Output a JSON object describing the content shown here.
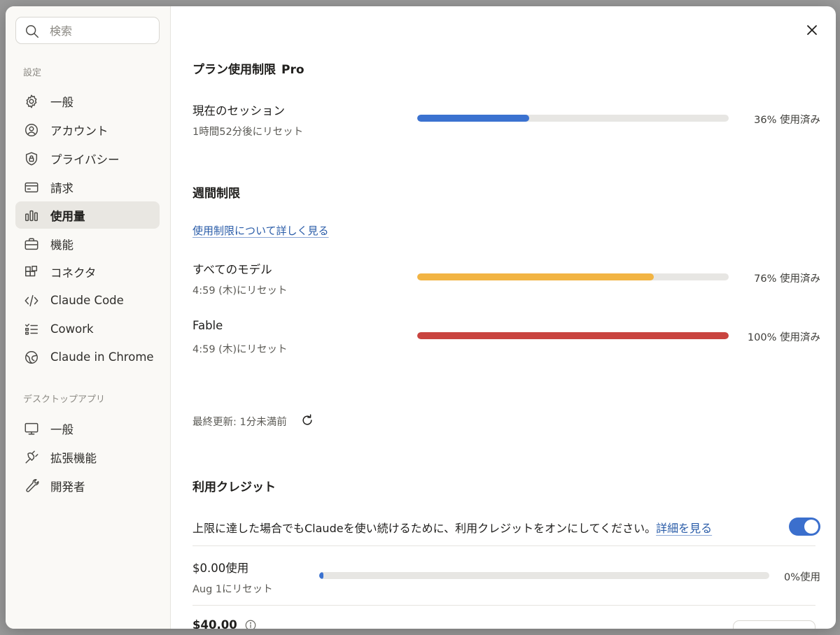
{
  "search": {
    "placeholder": "検索"
  },
  "sidebar": {
    "settings_section": "設定",
    "settings_items": [
      {
        "label": "一般",
        "icon": "gear-icon"
      },
      {
        "label": "アカウント",
        "icon": "user-circle-icon"
      },
      {
        "label": "プライバシー",
        "icon": "shield-lock-icon"
      },
      {
        "label": "請求",
        "icon": "credit-card-icon"
      },
      {
        "label": "使用量",
        "icon": "bar-chart-icon",
        "active": true
      },
      {
        "label": "機能",
        "icon": "briefcase-icon"
      },
      {
        "label": "コネクタ",
        "icon": "blocks-icon"
      },
      {
        "label": "Claude Code",
        "icon": "code-icon"
      },
      {
        "label": "Cowork",
        "icon": "checklist-icon"
      },
      {
        "label": "Claude in Chrome",
        "icon": "globe-icon"
      }
    ],
    "desktop_section": "デスクトップアプリ",
    "desktop_items": [
      {
        "label": "一般",
        "icon": "monitor-icon"
      },
      {
        "label": "拡張機能",
        "icon": "plug-icon"
      },
      {
        "label": "開発者",
        "icon": "wrench-icon"
      }
    ]
  },
  "main": {
    "plan_title": "プラン使用制限",
    "plan_name": "Pro",
    "session": {
      "title": "現在のセッション",
      "reset": "1時間52分後にリセット",
      "percent": 36,
      "percent_label": "36% 使用済み",
      "color": "#3b72d0"
    },
    "weekly_title": "週間制限",
    "weekly_link": "使用制限について詳しく見る",
    "weekly": [
      {
        "title": "すべてのモデル",
        "reset": "4:59 (木)にリセット",
        "percent": 76,
        "percent_label": "76% 使用済み",
        "color": "#f2b443"
      },
      {
        "title": "Fable",
        "reset": "4:59 (木)にリセット",
        "percent": 100,
        "percent_label": "100% 使用済み",
        "color": "#c9443f"
      }
    ],
    "last_updated": "最終更新: 1分未満前",
    "credits": {
      "title": "利用クレジット",
      "description": "上限に達した場合でもClaudeを使い続けるために、利用クレジットをオンにしてください。",
      "details_link": "詳細を見る",
      "toggle_on": true,
      "accent": "#3b6fcd",
      "usage_title": "$0.00使用",
      "usage_reset": "Aug 1にリセット",
      "usage_percent": 0,
      "usage_percent_label": "0%使用",
      "usage_color": "#3b72d0",
      "limit_amount": "$40.00"
    }
  }
}
